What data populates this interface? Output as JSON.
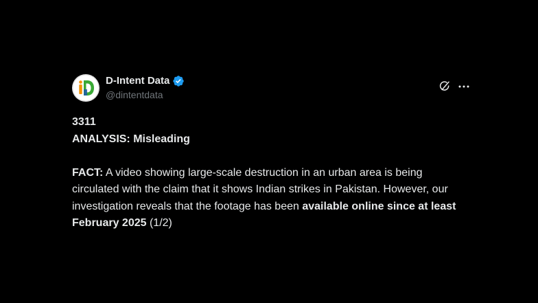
{
  "post": {
    "author": {
      "display_name": "D-Intent Data",
      "handle": "@dintentdata",
      "verified": true,
      "avatar_icon": "d-intent-logo",
      "verified_icon": "verified-badge-icon",
      "colors": {
        "logo_orange": "#f39200",
        "logo_green": "#3aa935",
        "logo_blue": "#1e5aa8",
        "verified_blue": "#1d9bf0"
      }
    },
    "actions": {
      "grok_icon": "grok-icon",
      "more_icon": "more-options-icon"
    },
    "text": {
      "line1": "3311",
      "line2": "ANALYSIS: Misleading",
      "fact_label": "FACT:",
      "fact_text_1": " A video showing large-scale destruction in an urban area is being circulated with the claim that it shows Indian strikes in Pakistan. However, our investigation reveals that the footage has been ",
      "fact_bold": "available online since at least February 2025",
      "fact_text_2": " (1/2)"
    }
  },
  "theme": {
    "background": "#000000",
    "text_primary": "#e7e9ea",
    "text_secondary": "#71767b"
  }
}
